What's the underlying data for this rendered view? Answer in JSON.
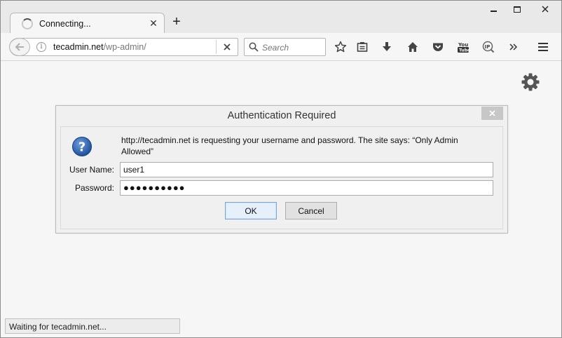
{
  "tab": {
    "title": "Connecting..."
  },
  "url": {
    "domain": "tecadmin.net",
    "path": "/wp-admin/"
  },
  "search": {
    "placeholder": "Search"
  },
  "toolbar_icons": [
    "star-icon",
    "reading-list-icon",
    "download-icon",
    "home-icon",
    "pocket-icon",
    "youtube-icon",
    "ip-icon",
    "overflow-icon",
    "menu-icon"
  ],
  "dialog": {
    "title": "Authentication Required",
    "message": "http://tecadmin.net is requesting your username and password. The site says: “Only Admin Allowed”",
    "username_label": "User Name:",
    "username_value": "user1",
    "password_label": "Password:",
    "password_mask": "●●●●●●●●●●",
    "ok_label": "OK",
    "cancel_label": "Cancel"
  },
  "status": {
    "text": "Waiting for tecadmin.net..."
  },
  "colors": {
    "question_icon": "#2b5fa8",
    "ok_border": "#7aa9d8"
  }
}
